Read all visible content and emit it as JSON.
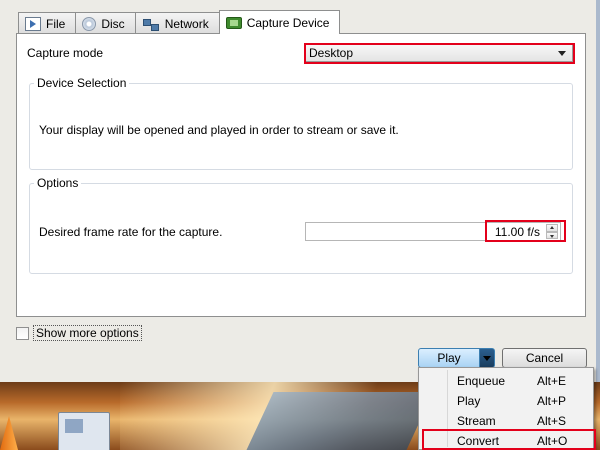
{
  "tabs": [
    {
      "label": "File",
      "icon": "file-icon",
      "active": false
    },
    {
      "label": "Disc",
      "icon": "disc-icon",
      "active": false
    },
    {
      "label": "Network",
      "icon": "network-icon",
      "active": false
    },
    {
      "label": "Capture Device",
      "icon": "capture-device-icon",
      "active": true
    }
  ],
  "capture_mode": {
    "label": "Capture mode",
    "selected": "Desktop"
  },
  "device_selection": {
    "title": "Device Selection",
    "description": "Your display will be opened and played in order to stream or save it."
  },
  "options": {
    "title": "Options",
    "frame_rate_label": "Desired frame rate for the capture.",
    "frame_rate_value": "11.00 f/s"
  },
  "show_more_options": {
    "label": "Show more options",
    "checked": false
  },
  "buttons": {
    "play": "Play",
    "cancel": "Cancel"
  },
  "play_menu": [
    {
      "label": "Enqueue",
      "shortcut": "Alt+E"
    },
    {
      "label": "Play",
      "shortcut": "Alt+P"
    },
    {
      "label": "Stream",
      "shortcut": "Alt+S"
    },
    {
      "label": "Convert",
      "shortcut": "Alt+O"
    }
  ],
  "colors": {
    "highlight": "#e3001b",
    "play_button": "#a9d3f4"
  }
}
